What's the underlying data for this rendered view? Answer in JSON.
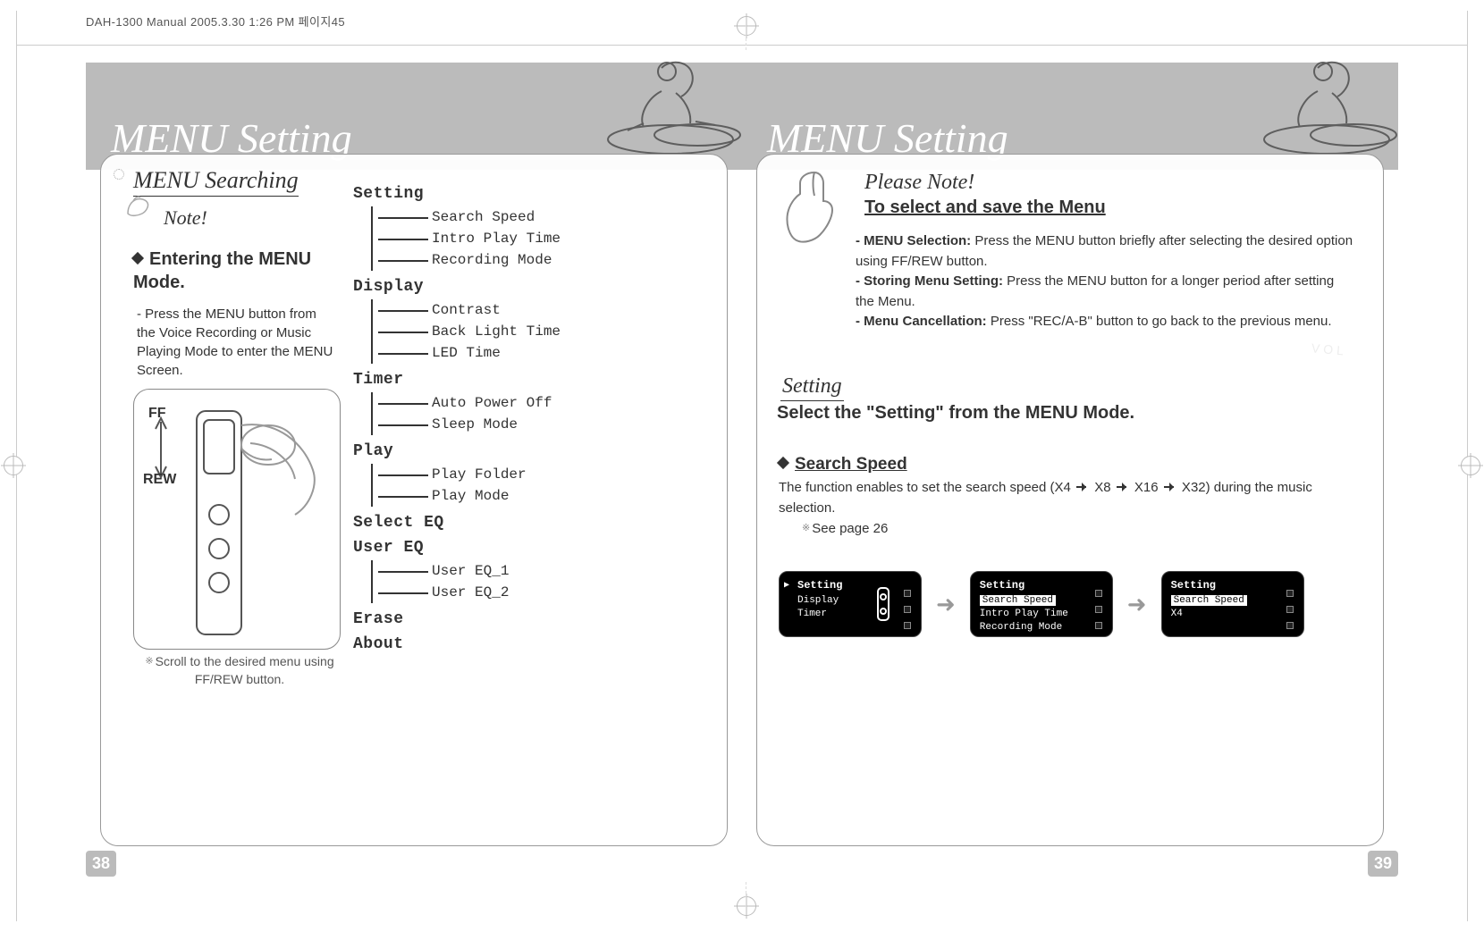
{
  "meta_header": "DAH-1300 Manual 2005.3.30 1:26 PM 페이지45",
  "page_left_num": "38",
  "page_right_num": "39",
  "section_title": "MENU Setting",
  "left": {
    "heading": "MENU Searching",
    "note_label": "Note!",
    "entering_heading": "Entering the MENU Mode.",
    "entering_body": "- Press the MENU button from the Voice Recording or Music Playing Mode to enter the MENU Screen.",
    "scroll_note": "Scroll to the desired menu using FF/REW button.",
    "ff_label": "FF",
    "rew_label": "REW",
    "tree": [
      {
        "title": "Setting",
        "items": [
          "Search Speed",
          "Intro Play Time",
          "Recording Mode"
        ]
      },
      {
        "title": "Display",
        "items": [
          "Contrast",
          "Back Light Time",
          "LED Time"
        ]
      },
      {
        "title": "Timer",
        "items": [
          "Auto Power Off",
          "Sleep Mode"
        ]
      },
      {
        "title": "Play",
        "items": [
          "Play Folder",
          "Play Mode"
        ]
      },
      {
        "title": "Select EQ",
        "items": []
      },
      {
        "title": "User EQ",
        "items": [
          "User EQ_1",
          "User EQ_2"
        ]
      },
      {
        "title": "Erase",
        "items": []
      },
      {
        "title": "About",
        "items": []
      }
    ]
  },
  "right": {
    "please_note": "Please Note!",
    "to_select": "To select and save the Menu",
    "bullets": [
      {
        "b": "- MENU Selection:",
        "t": " Press the MENU button briefly after selecting the desired option using FF/REW button."
      },
      {
        "b": "- Storing Menu Setting:",
        "t": " Press the MENU button for a longer period after setting the Menu."
      },
      {
        "b": "- Menu Cancellation:",
        "t": " Press \"REC/A-B\" button to go back to the previous menu."
      }
    ],
    "setting_h": "Setting",
    "setting_line": "Select the \"Setting\" from the MENU Mode.",
    "vol_ghost": "VOL",
    "ss_h": "Search Speed",
    "ss_body_pre": "The function enables to set the search speed (X4 ",
    "ss_body_mid1": " X8 ",
    "ss_body_mid2": " X16 ",
    "ss_body_post": " X32) during the music selection.",
    "see_page": "See page 26",
    "screen1": {
      "title": "Setting",
      "rows": [
        "Display",
        "Timer"
      ],
      "ptr": "▶",
      "selected": 0
    },
    "screen2": {
      "title": "Setting",
      "rows": [
        "Search Speed",
        "Intro Play Time",
        "Recording Mode"
      ],
      "hl": 0
    },
    "screen3": {
      "title": "Setting",
      "rows": [
        "Search Speed",
        "X4"
      ],
      "hl": 0
    }
  }
}
